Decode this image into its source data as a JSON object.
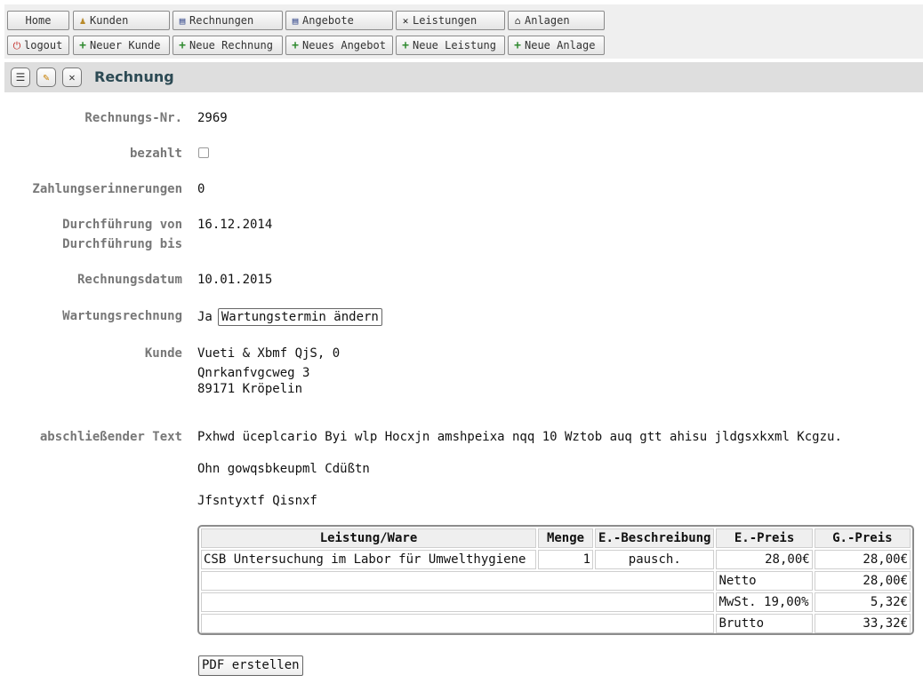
{
  "nav": {
    "row1": [
      {
        "label": "Home",
        "icon": ""
      },
      {
        "label": "Kunden",
        "icon": "person-icon"
      },
      {
        "label": "Rechnungen",
        "icon": "document-icon"
      },
      {
        "label": "Angebote",
        "icon": "document-icon"
      },
      {
        "label": "Leistungen",
        "icon": "tools-icon"
      },
      {
        "label": "Anlagen",
        "icon": "building-icon"
      }
    ],
    "row2": [
      {
        "label": "logout",
        "icon": "power-icon"
      },
      {
        "label": "Neuer Kunde",
        "icon": "plus-icon"
      },
      {
        "label": "Neue Rechnung",
        "icon": "plus-icon"
      },
      {
        "label": "Neues Angebot",
        "icon": "plus-icon"
      },
      {
        "label": "Neue Leistung",
        "icon": "plus-icon"
      },
      {
        "label": "Neue Anlage",
        "icon": "plus-icon"
      }
    ]
  },
  "title": "Rechnung",
  "fields": {
    "rechnungs_nr": {
      "label": "Rechnungs-Nr.",
      "value": "2969"
    },
    "bezahlt": {
      "label": "bezahlt",
      "checked": false
    },
    "zahlungserinnerungen": {
      "label": "Zahlungserinnerungen",
      "value": "0"
    },
    "durchfuehrung_von": {
      "label": "Durchführung von",
      "value": "16.12.2014"
    },
    "durchfuehrung_bis": {
      "label": "Durchführung bis",
      "value": ""
    },
    "rechnungsdatum": {
      "label": "Rechnungsdatum",
      "value": "10.01.2015"
    },
    "wartungsrechnung": {
      "label": "Wartungsrechnung",
      "value": "Ja",
      "button": "Wartungstermin ändern"
    },
    "kunde": {
      "label": "Kunde",
      "line1": "Vueti & Xbmf QjS, 0",
      "line2": "Qnrkanfvgcweg 3",
      "line3": "89171 Kröpelin"
    },
    "abschliessender_text": {
      "label": "abschließender Text",
      "line1": "Pxhwd üceplcario Byi wlp Hocxjn amshpeixa nqq 10 Wztob auq gtt ahisu jldgsxkxml Kcgzu.",
      "line2": "Ohn gowqsbkeupml Cdüßtn",
      "line3": "Jfsntyxtf Qisnxf"
    }
  },
  "table": {
    "headers": [
      "Leistung/Ware",
      "Menge",
      "E.-Beschreibung",
      "E.-Preis",
      "G.-Preis"
    ],
    "item": {
      "leistung": "CSB Untersuchung im Labor für Umwelthygiene",
      "menge": "1",
      "beschreibung": "pausch.",
      "e_preis": "28,00€",
      "g_preis": "28,00€"
    },
    "netto": {
      "label": "Netto",
      "value": "28,00€"
    },
    "mwst": {
      "label": "MwSt. 19,00%",
      "value": "5,32€"
    },
    "brutto": {
      "label": "Brutto",
      "value": "33,32€"
    }
  },
  "pdf_button": "PDF erstellen"
}
